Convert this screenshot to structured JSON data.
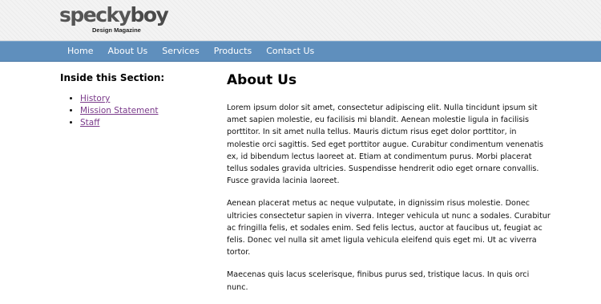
{
  "logo": {
    "main_a": "specky",
    "main_b": "boy",
    "sub": "Design Magazine"
  },
  "nav": {
    "items": [
      "Home",
      "About Us",
      "Services",
      "Products",
      "Contact Us"
    ]
  },
  "sidebar": {
    "heading": "Inside this Section:",
    "links": [
      "History",
      "Mission Statement",
      "Staff"
    ]
  },
  "main": {
    "title": "About Us",
    "paragraphs": [
      "Lorem ipsum dolor sit amet, consectetur adipiscing elit. Nulla tincidunt ipsum sit amet sapien molestie, eu facilisis mi blandit. Aenean molestie ligula in facilisis porttitor. In sit amet nulla tellus. Mauris dictum risus eget dolor porttitor, in molestie orci sagittis. Sed eget porttitor augue. Curabitur condimentum venenatis ex, id bibendum lectus laoreet at. Etiam at condimentum purus. Morbi placerat tellus sodales gravida ultricies. Suspendisse hendrerit odio eget ornare convallis. Fusce gravida lacinia laoreet.",
      "Aenean placerat metus ac neque vulputate, in dignissim risus molestie. Donec ultricies consectetur sapien in viverra. Integer vehicula ut nunc a sodales. Curabitur ac fringilla felis, et sodales enim. Sed felis lectus, auctor at faucibus ut, feugiat ac felis. Donec vel nulla sit amet ligula vehicula eleifend quis eget mi. Ut ac viverra tortor.",
      "Maecenas quis lacus scelerisque, finibus purus sed, tristique lacus. In quis orci nunc."
    ]
  }
}
